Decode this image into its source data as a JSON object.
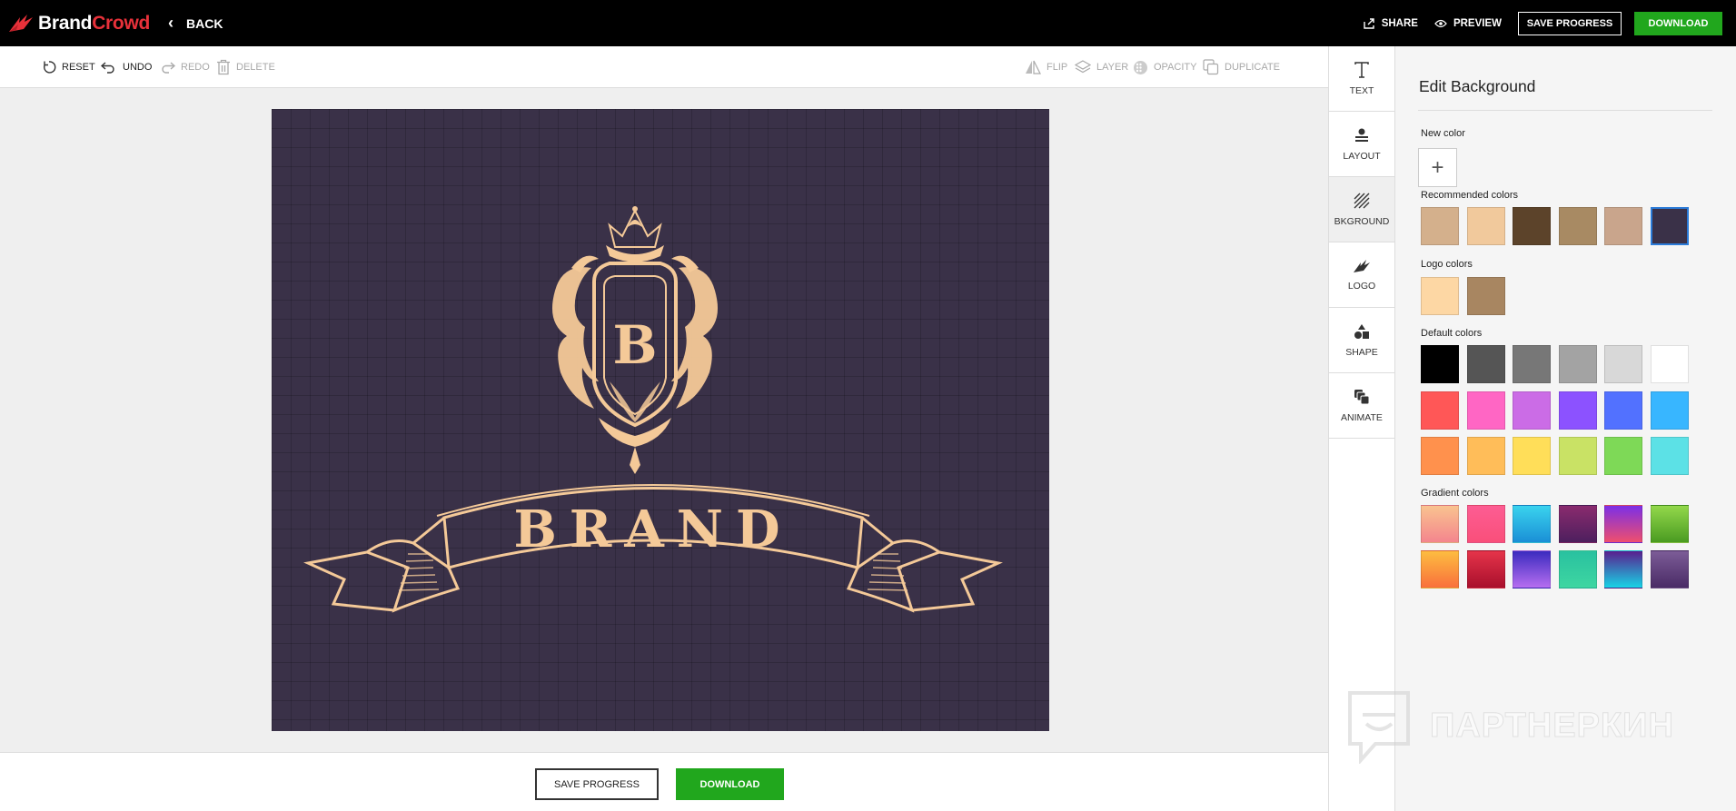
{
  "header": {
    "logo_brand": "Brand",
    "logo_crowd": "Crowd",
    "back_label": "BACK",
    "share_label": "SHARE",
    "preview_label": "PREVIEW",
    "save_progress_label": "SAVE PROGRESS",
    "download_label": "DOWNLOAD"
  },
  "toolbar": {
    "reset": "RESET",
    "undo": "UNDO",
    "redo": "REDO",
    "delete": "DELETE",
    "flip": "FLIP",
    "layer": "LAYER",
    "opacity": "OPACITY",
    "duplicate": "DUPLICATE"
  },
  "canvas": {
    "background_color": "#3a3148",
    "emblem_letter": "B",
    "banner_text": "BRAND",
    "art_color": "#f4c998"
  },
  "bottom": {
    "save_progress_label": "SAVE PROGRESS",
    "download_label": "DOWNLOAD"
  },
  "sidetabs": [
    {
      "label": "TEXT",
      "icon": "text-icon"
    },
    {
      "label": "LAYOUT",
      "icon": "layout-icon"
    },
    {
      "label": "BKGROUND",
      "icon": "background-icon"
    },
    {
      "label": "LOGO",
      "icon": "logo-icon"
    },
    {
      "label": "SHAPE",
      "icon": "shape-icon"
    },
    {
      "label": "ANIMATE",
      "icon": "animate-icon"
    }
  ],
  "panel": {
    "title": "Edit Background",
    "new_color_label": "New color",
    "new_color_button": "+",
    "recommended_label": "Recommended colors",
    "recommended": [
      "#d4b08c",
      "#f1c99c",
      "#5c432a",
      "#a88a63",
      "#c9a58c",
      "#3a3148"
    ],
    "recommended_selected": "#3a3148",
    "logo_label": "Logo colors",
    "logo_colors": [
      "#fdd7a4",
      "#a88661"
    ],
    "default_label": "Default colors",
    "default_colors": [
      [
        "#000000",
        "#555555",
        "#777777",
        "#a3a3a3",
        "#d8d8d8",
        "#ffffff"
      ],
      [
        "#ff5757",
        "#ff66c4",
        "#cb6ce6",
        "#8c52ff",
        "#5271ff",
        "#38b6ff"
      ],
      [
        "#ff914d",
        "#ffbd59",
        "#ffde59",
        "#c9e265",
        "#7ed957",
        "#5ce1e6"
      ]
    ],
    "gradient_label": "Gradient colors",
    "gradients": [
      [
        "linear-gradient(180deg,#f9c38f,#f4858e)",
        "linear-gradient(180deg,#fd5d93,#f94f7a)",
        "linear-gradient(180deg,#3ad3ee,#1a8fd6)",
        "linear-gradient(180deg,#8a2b6e,#4d1f5e)",
        "linear-gradient(180deg,#7c2fe6,#ef4f6d)",
        "linear-gradient(180deg,#93d84b,#4a9b21)"
      ],
      [
        "linear-gradient(180deg,#fdbd40,#f9703c)",
        "linear-gradient(180deg,#e5344a,#a90f2c)",
        "linear-gradient(180deg,#3b2bbf,#b66ef0)",
        "linear-gradient(180deg,#29c1a0,#3ed6a1)",
        "linear-gradient(180deg,#5a1e8e,#17d3e6)",
        "linear-gradient(180deg,#7c5c97,#4a2b66)"
      ]
    ]
  },
  "watermark": {
    "text": "ПАРТНЕРКИН"
  }
}
